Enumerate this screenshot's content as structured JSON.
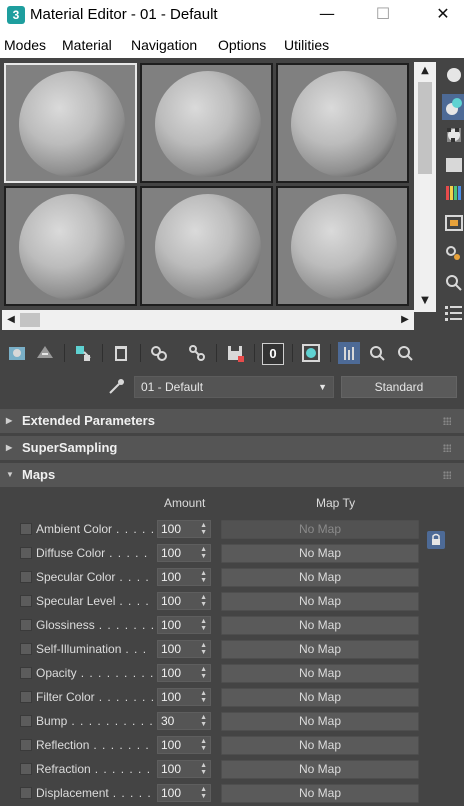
{
  "window": {
    "title": "Material Editor - 01 - Default",
    "app_icon_label": "3",
    "controls": {
      "minimize": "—",
      "maximize": "☐",
      "close": "✕"
    }
  },
  "menubar": {
    "items": [
      "Modes",
      "Material",
      "Navigation",
      "Options",
      "Utilities"
    ]
  },
  "sample_slots": {
    "count": 6,
    "active_index": 0
  },
  "scrollbars": {
    "up": "▲",
    "down": "▼",
    "left": "◀",
    "right": "▶"
  },
  "right_toolbar": {
    "icons": [
      "sample-type-icon",
      "backlight-icon",
      "background-icon",
      "uv-tiling-icon",
      "video-color-check-icon",
      "make-preview-icon",
      "options-icon",
      "select-by-material-icon",
      "material-map-navigator-icon"
    ],
    "active_index": 1
  },
  "toolbar": {
    "icons": [
      "get-material-icon",
      "put-to-scene-icon",
      "assign-to-selection-icon",
      "reset-map-icon",
      "make-unique-icon",
      "put-to-library-icon",
      "material-id-channel-icon",
      "show-shaded-material-icon",
      "show-end-result-icon",
      "go-to-parent-icon",
      "go-forward-to-sibling-icon"
    ],
    "material_id": "0"
  },
  "material": {
    "name": "01 - Default",
    "type": "Standard",
    "dropdown_arrow": "▼"
  },
  "rollouts": [
    {
      "label": "Extended Parameters",
      "collapsed": true,
      "arrow": "▶"
    },
    {
      "label": "SuperSampling",
      "collapsed": true,
      "arrow": "▶"
    },
    {
      "label": "Maps",
      "collapsed": false,
      "arrow": "▼"
    }
  ],
  "maps": {
    "col_amount": "Amount",
    "col_map": "Map Ty",
    "no_map": "No Map",
    "rows": [
      {
        "label": "Ambient Color",
        "dots": ". . . . .",
        "amount": "100",
        "disabled": true
      },
      {
        "label": "Diffuse Color",
        "dots": ". . . . .",
        "amount": "100",
        "disabled": false
      },
      {
        "label": "Specular Color",
        "dots": ". . . .",
        "amount": "100",
        "disabled": false
      },
      {
        "label": "Specular Level",
        "dots": ". . . .",
        "amount": "100",
        "disabled": false
      },
      {
        "label": "Glossiness",
        "dots": ". . . . . . . .",
        "amount": "100",
        "disabled": false
      },
      {
        "label": "Self-Illumination",
        "dots": ". . .",
        "amount": "100",
        "disabled": false
      },
      {
        "label": "Opacity",
        "dots": ". . . . . . . . .",
        "amount": "100",
        "disabled": false
      },
      {
        "label": "Filter Color",
        "dots": ". . . . . . .",
        "amount": "100",
        "disabled": false
      },
      {
        "label": "Bump",
        "dots": ". . . . . . . . . .",
        "amount": "30",
        "disabled": false
      },
      {
        "label": "Reflection",
        "dots": ". . . . . . .",
        "amount": "100",
        "disabled": false
      },
      {
        "label": "Refraction",
        "dots": ". . . . . . .",
        "amount": "100",
        "disabled": false
      },
      {
        "label": "Displacement",
        "dots": ". . . . .",
        "amount": "100",
        "disabled": false
      }
    ]
  },
  "colors": {
    "panel": "#444444",
    "accent": "#4d6a96",
    "header": "#555555"
  }
}
